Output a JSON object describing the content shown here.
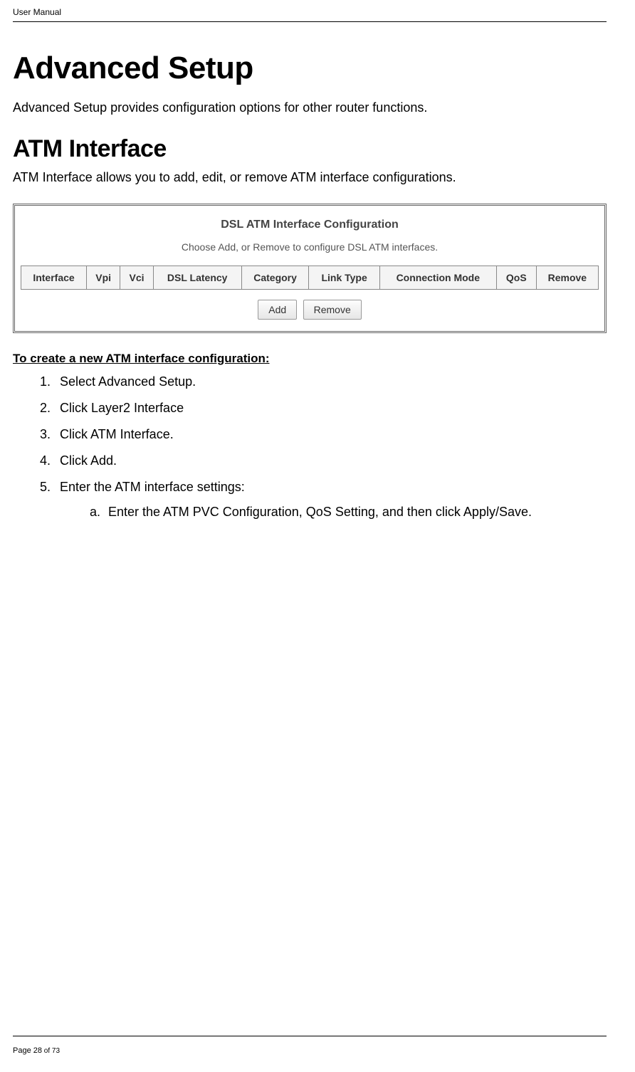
{
  "header": {
    "running_head": "User Manual"
  },
  "footer": {
    "page_label_prefix": "Page ",
    "page_current": "28",
    "page_of": " of 73"
  },
  "titles": {
    "h1": "Advanced Setup",
    "h1_desc": "Advanced Setup provides configuration options for other router functions.",
    "h2": "ATM Interface",
    "h2_desc": "ATM Interface allows you to add, edit, or remove ATM interface configurations."
  },
  "panel": {
    "title": "DSL ATM Interface Configuration",
    "subtitle": "Choose Add, or Remove to configure DSL ATM interfaces.",
    "columns": [
      "Interface",
      "Vpi",
      "Vci",
      "DSL Latency",
      "Category",
      "Link Type",
      "Connection Mode",
      "QoS",
      "Remove"
    ],
    "buttons": {
      "add": "Add",
      "remove": "Remove"
    }
  },
  "procedure": {
    "heading": "To create a new ATM interface configuration:",
    "steps": [
      "Select Advanced Setup.",
      "Click Layer2 Interface",
      "Click ATM Interface.",
      "Click Add.",
      "Enter the ATM interface settings:"
    ],
    "substeps_of_5": [
      "Enter the ATM PVC Configuration, QoS Setting, and then click Apply/Save."
    ]
  }
}
